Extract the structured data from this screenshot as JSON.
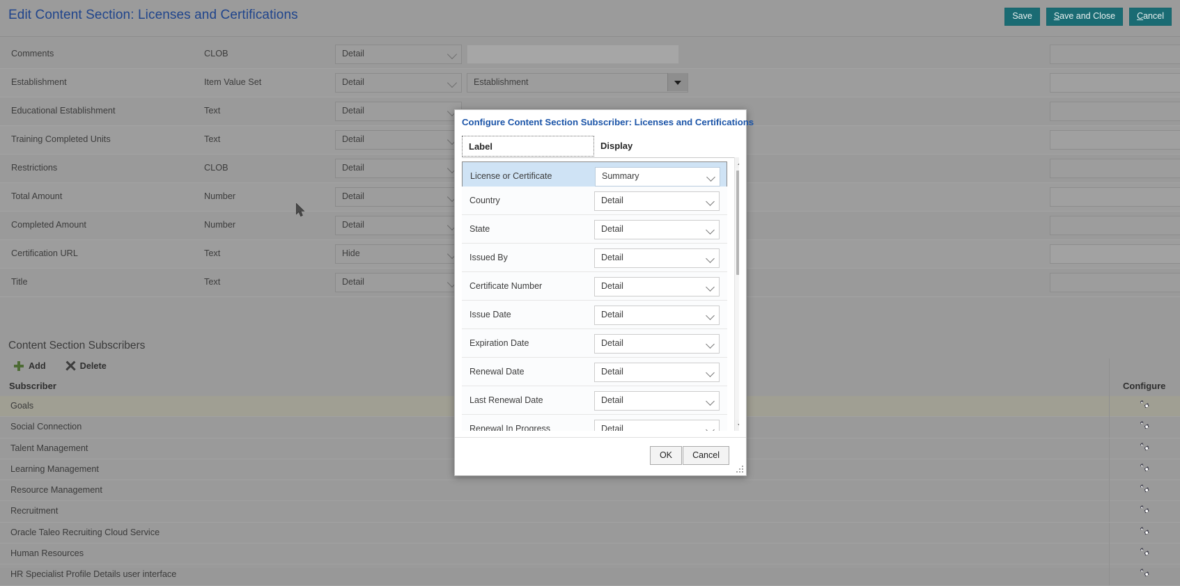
{
  "header": {
    "title": "Edit Content Section: Licenses and Certifications",
    "buttons": [
      {
        "label": "Save",
        "accesskey": ""
      },
      {
        "label": "Save and Close",
        "accesskey": "S"
      },
      {
        "label": "Cancel",
        "accesskey": "C"
      }
    ]
  },
  "attributes": {
    "rows": [
      {
        "name": "Comments",
        "type": "CLOB",
        "display": "Detail",
        "value": "",
        "kind": "box"
      },
      {
        "name": "Establishment",
        "type": "Item Value Set",
        "display": "Detail",
        "value": "Establishment",
        "kind": "lov"
      },
      {
        "name": "Educational Establishment",
        "type": "Text",
        "display": "Detail",
        "value": "",
        "kind": "none"
      },
      {
        "name": "Training Completed Units",
        "type": "Text",
        "display": "Detail",
        "value": "",
        "kind": "none"
      },
      {
        "name": "Restrictions",
        "type": "CLOB",
        "display": "Detail",
        "value": "",
        "kind": "none"
      },
      {
        "name": "Total Amount",
        "type": "Number",
        "display": "Detail",
        "value": "",
        "kind": "none"
      },
      {
        "name": "Completed Amount",
        "type": "Number",
        "display": "Detail",
        "value": "",
        "kind": "none"
      },
      {
        "name": "Certification URL",
        "type": "Text",
        "display": "Hide",
        "value": "",
        "kind": "none"
      },
      {
        "name": "Title",
        "type": "Text",
        "display": "Detail",
        "value": "",
        "kind": "none"
      }
    ]
  },
  "subscribers": {
    "section_title": "Content Section Subscribers",
    "toolbar": {
      "add_label": "Add",
      "delete_label": "Delete"
    },
    "columns": {
      "subscriber": "Subscriber",
      "configure": "Configure"
    },
    "rows": [
      {
        "name": "Goals",
        "selected": true
      },
      {
        "name": "Social Connection",
        "selected": false
      },
      {
        "name": "Talent Management",
        "selected": false
      },
      {
        "name": "Learning Management",
        "selected": false
      },
      {
        "name": "Resource Management",
        "selected": false
      },
      {
        "name": "Recruitment",
        "selected": false
      },
      {
        "name": "Oracle Taleo Recruiting Cloud Service",
        "selected": false
      },
      {
        "name": "Human Resources",
        "selected": false
      },
      {
        "name": "HR Specialist Profile Details user interface",
        "selected": false
      }
    ]
  },
  "dialog": {
    "title": "Configure Content Section Subscriber: Licenses and Certifications",
    "columns": {
      "label": "Label",
      "display": "Display"
    },
    "rows": [
      {
        "label": "License or Certificate",
        "display": "Summary",
        "selected": true
      },
      {
        "label": "Country",
        "display": "Detail",
        "selected": false
      },
      {
        "label": "State",
        "display": "Detail",
        "selected": false
      },
      {
        "label": "Issued By",
        "display": "Detail",
        "selected": false
      },
      {
        "label": "Certificate Number",
        "display": "Detail",
        "selected": false
      },
      {
        "label": "Issue Date",
        "display": "Detail",
        "selected": false
      },
      {
        "label": "Expiration Date",
        "display": "Detail",
        "selected": false
      },
      {
        "label": "Renewal Date",
        "display": "Detail",
        "selected": false
      },
      {
        "label": "Last Renewal Date",
        "display": "Detail",
        "selected": false
      },
      {
        "label": "Renewal In Progress",
        "display": "Detail",
        "selected": false
      }
    ],
    "footer": {
      "ok_label": "OK",
      "cancel_label": "Cancel"
    }
  },
  "icons": {
    "add": "plus-icon",
    "delete": "x-icon",
    "configure": "gears-icon",
    "dropdown": "chevron-down-icon",
    "scroll_up": "scroll-up-arrow-icon",
    "scroll_down": "scroll-down-arrow-icon",
    "resize": "resize-grip-icon",
    "cursor": "mouse-pointer-icon"
  },
  "colors": {
    "title": "#20458c",
    "button": "#1a6b73",
    "dialog_title": "#1c55a8",
    "row_selected": "#cfe3f5",
    "subscriber_selected": "#a09f93",
    "page_background": "#9a9a9a"
  }
}
